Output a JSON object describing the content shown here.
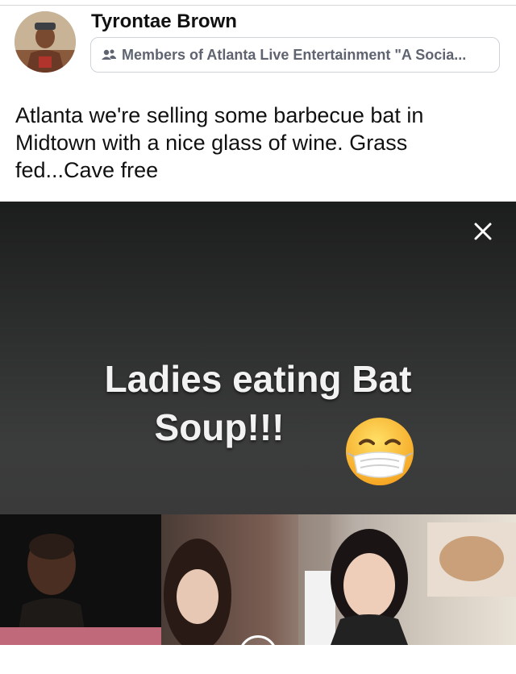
{
  "post": {
    "author": "Tyrontae Brown",
    "group": "Members of Atlanta Live Entertainment \"A Socia...",
    "text": "Atlanta we're selling some barbecue bat in Midtown with a nice glass of wine.  Grass fed...Cave free"
  },
  "media": {
    "caption_line1": "Ladies eating Bat",
    "caption_line2": "Soup!!!",
    "emoji": "face-with-medical-mask",
    "close_icon": "close-icon"
  },
  "colors": {
    "text": "#111111",
    "muted": "#5f6470",
    "pill_border": "#cfd3d8",
    "media_bg": "#2b2c2c",
    "caption": "#f2f2f2"
  }
}
